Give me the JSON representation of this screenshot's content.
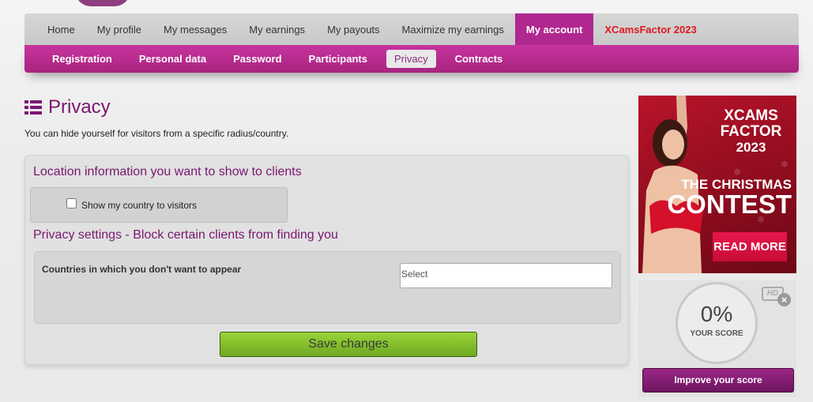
{
  "top_nav": {
    "items": [
      {
        "label": "Home"
      },
      {
        "label": "My profile"
      },
      {
        "label": "My messages"
      },
      {
        "label": "My earnings"
      },
      {
        "label": "My payouts"
      },
      {
        "label": "Maximize my earnings"
      },
      {
        "label": "My account"
      },
      {
        "label": "XCamsFactor 2023"
      }
    ],
    "active": "My account"
  },
  "sub_nav": {
    "items": [
      {
        "label": "Registration"
      },
      {
        "label": "Personal data"
      },
      {
        "label": "Password"
      },
      {
        "label": "Participants"
      },
      {
        "label": "Privacy"
      },
      {
        "label": "Contracts"
      }
    ],
    "active": "Privacy"
  },
  "page": {
    "title": "Privacy",
    "intro": "You can hide yourself for visitors from a specific radius/country."
  },
  "location_section": {
    "title": "Location information you want to show to clients",
    "checkbox_label": "Show my country to visitors",
    "checked": false
  },
  "privacy_section": {
    "title": "Privacy settings - Block certain clients from finding you",
    "countries_label": "Countries in which you don't want to appear",
    "select_placeholder": "Select"
  },
  "save_button": "Save changes",
  "promo": {
    "line1": "XCAMS",
    "line2": "FACTOR",
    "year": "2023",
    "christmas": "THE CHRISTMAS",
    "contest": "CONTEST",
    "read_more": "READ MORE"
  },
  "score": {
    "value": "0%",
    "label": "YOUR SCORE",
    "hd_badge": "HD",
    "improve_button": "Improve your score"
  },
  "colors": {
    "brand_purple": "#b0288f",
    "title_purple": "#7a1670",
    "contest_red": "#e0171f",
    "save_green": "#8cc63f"
  }
}
